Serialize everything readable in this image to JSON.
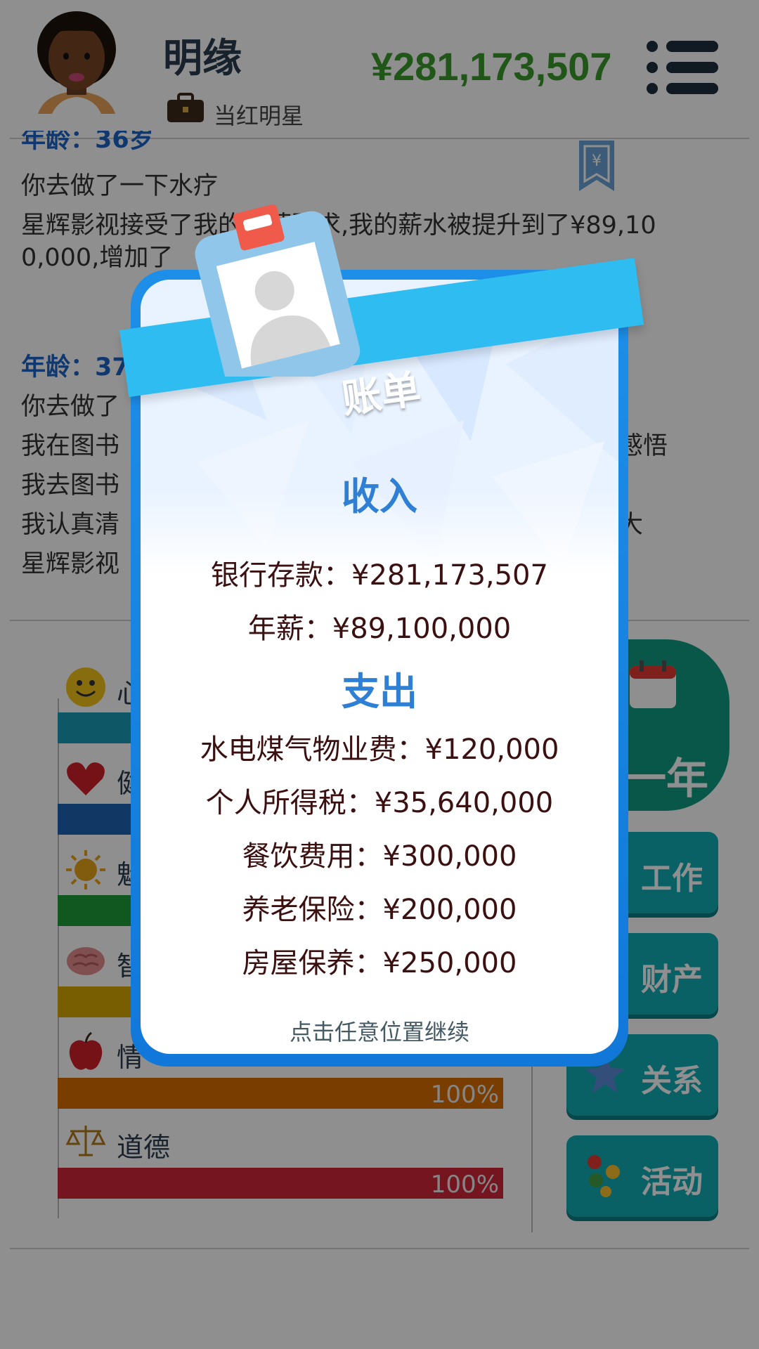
{
  "header": {
    "name": "明缘",
    "job_title": "当红明星",
    "money": "¥281,173,507"
  },
  "log": {
    "lines": [
      {
        "text": "年龄：36岁",
        "kind": "age"
      },
      {
        "text": "你去做了一下水疗",
        "kind": "text"
      },
      {
        "text": "星辉影视接受了我的加薪要求,我的薪水被提升到了¥89,10",
        "kind": "text"
      },
      {
        "text": "0,000,增加了",
        "kind": "text"
      },
      {
        "text": "年龄：37",
        "kind": "age"
      },
      {
        "text": "你去做了",
        "kind": "text"
      },
      {
        "text": "我在图书",
        "kind": "text"
      },
      {
        "text": "我去图书",
        "kind": "text"
      },
      {
        "text": "我认真清",
        "kind": "text"
      },
      {
        "text": "星辉影视",
        "kind": "text"
      }
    ],
    "right_fragments": [
      "感悟",
      "大"
    ]
  },
  "stats": [
    {
      "label": "心",
      "icon": "smiley-icon",
      "color": "#1a9bb8",
      "pct": null
    },
    {
      "label": "健",
      "icon": "heart-icon",
      "color": "#1f63b5",
      "pct": null
    },
    {
      "label": "魅",
      "icon": "sun-icon",
      "color": "#1f9b3a",
      "pct": null
    },
    {
      "label": "智",
      "icon": "brain-icon",
      "color": "#d6a800",
      "pct": null
    },
    {
      "label": "情",
      "icon": "apple-icon",
      "color": "#d86e00",
      "pct": "100%"
    },
    {
      "label": "道德",
      "icon": "scales-icon",
      "color": "#d1263a",
      "pct": "100%"
    }
  ],
  "buttons": {
    "next_year": "一年",
    "work": "工作",
    "assets": "财产",
    "relations": "关系",
    "activities": "活动"
  },
  "bill": {
    "title": "账单",
    "income_heading": "收入",
    "income": [
      "银行存款：¥281,173,507",
      "年薪：¥89,100,000"
    ],
    "expense_heading": "支出",
    "expenses": [
      "水电煤气物业费：¥120,000",
      "个人所得税：¥35,640,000",
      "餐饮费用：¥300,000",
      "养老保险：¥200,000",
      "房屋保养：¥250,000"
    ],
    "continue_hint": "点击任意位置继续"
  }
}
